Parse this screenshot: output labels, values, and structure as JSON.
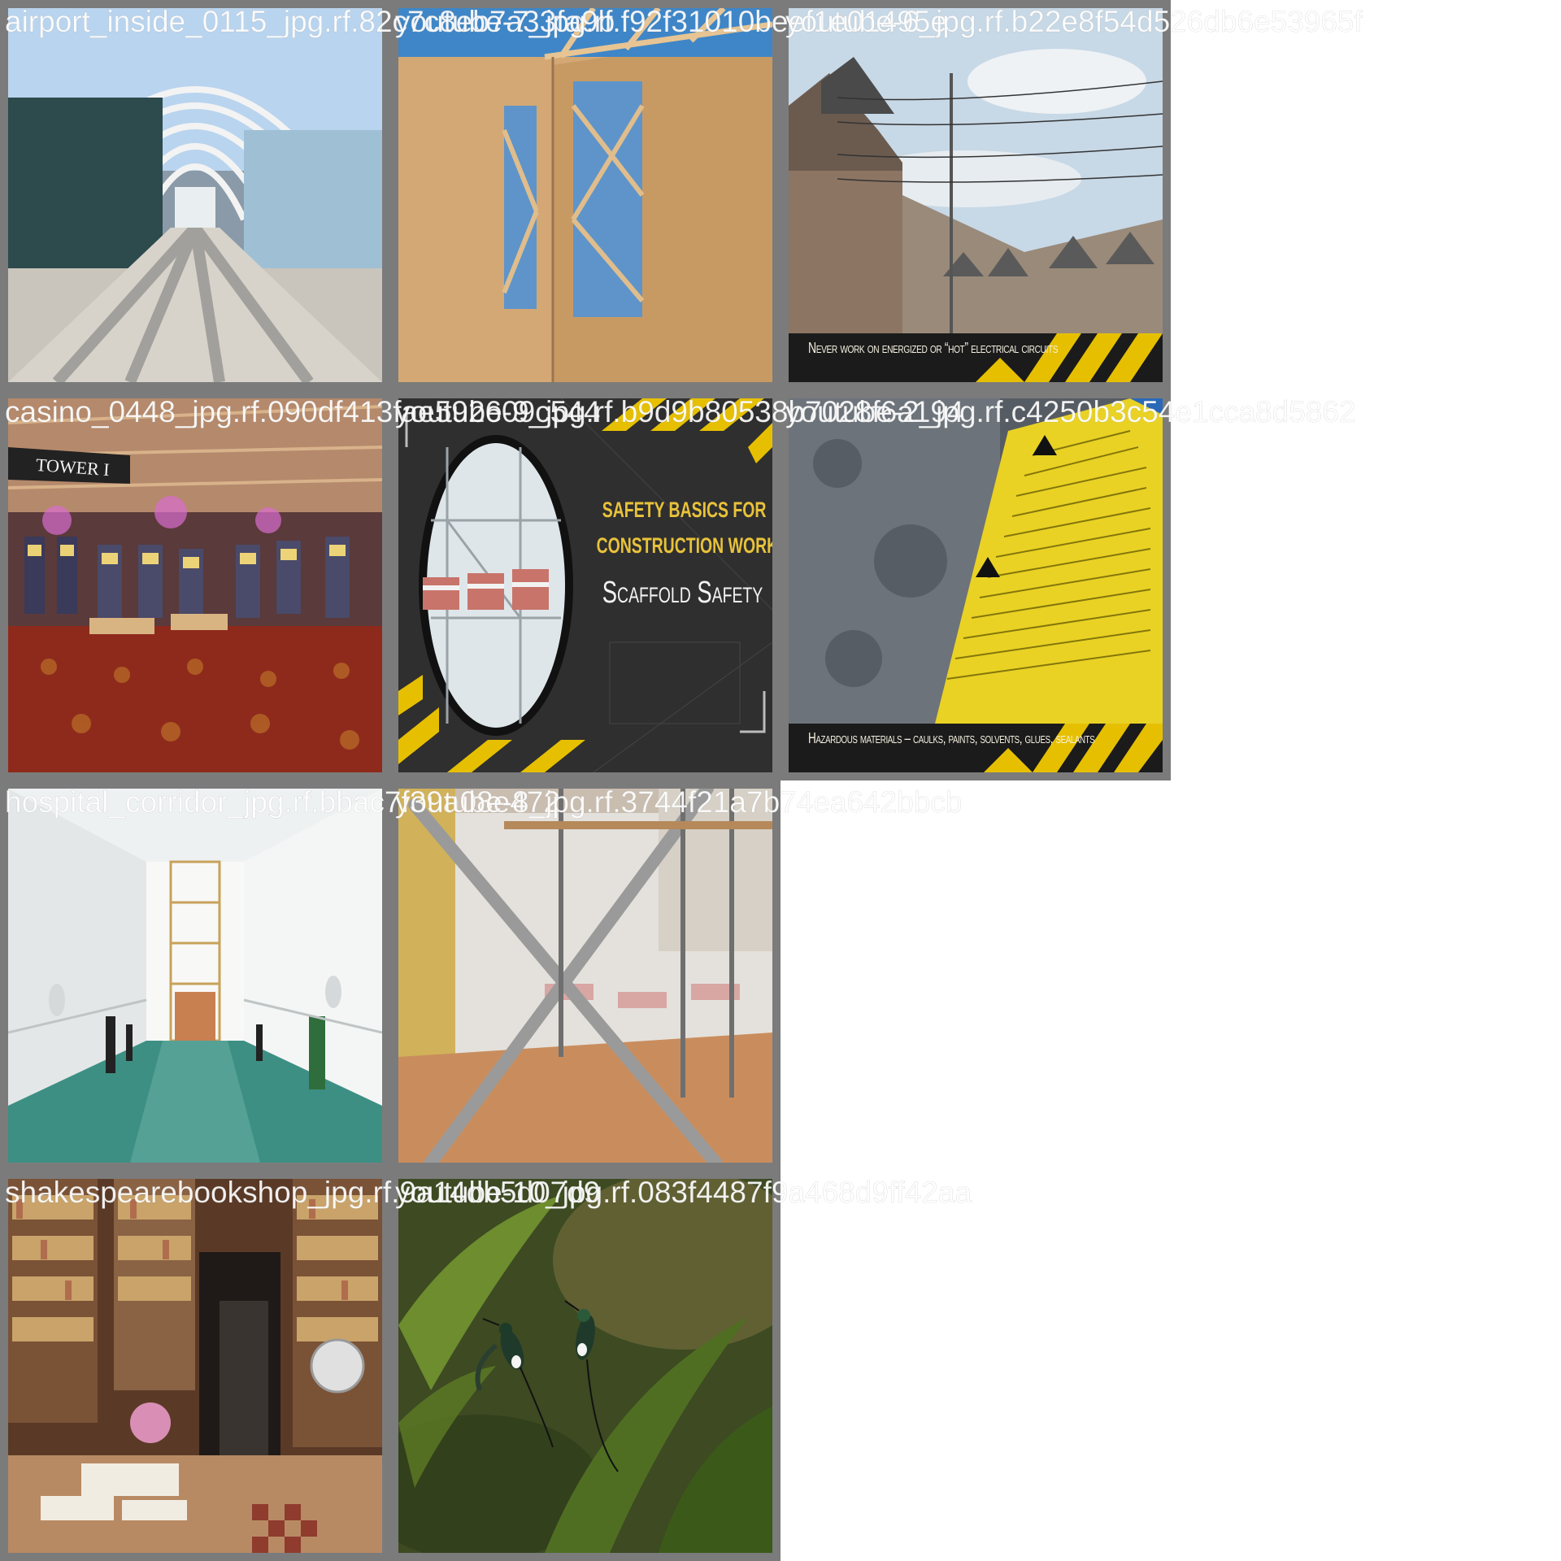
{
  "tiles": [
    {
      "caption": "airport_inside_0115_jpg.rf.82c7c8eb7a33fa9b"
    },
    {
      "caption": "youtube-7_jpg.rf.f92f31010beef1e01495e"
    },
    {
      "caption": "youtube-6_jpg.rf.b22e8f54d526db6e53965f",
      "banner": "Never work on energized or “hot” electrical circuits"
    },
    {
      "caption": "casino_0448_jpg.rf.090df413fae592609c544",
      "sign": "TOWER I"
    },
    {
      "caption": "youtube-9_jpg.rf.b9d9b80538b7028f6a194",
      "title_line1": "SAFETY BASICS FOR",
      "title_line2": "CONSTRUCTION WORKERS",
      "title_line3": "Scaffold Safety"
    },
    {
      "caption": "youtube-2_jpg.rf.c4250b3c54e1cca8d5862",
      "banner": "Hazardous materials – caulks, paints, solvents, glues, sealants"
    },
    {
      "caption": "hospital_corridor_jpg.rf.bbac7f39a08e472"
    },
    {
      "caption": "youtube-8_jpg.rf.3744f21a7b74ea642bbcb"
    },
    {
      "caption": "shakespearebookshop_jpg.rf.9a14db5d07d9"
    },
    {
      "caption": "youtube-10_jpg.rf.083f4487f9a468d9ff42aa"
    }
  ],
  "colors": {
    "frame": "#7b7b7b",
    "caption": "#ffffff",
    "hazard_yellow": "#e6c000",
    "hazard_black": "#1a1a1a"
  }
}
